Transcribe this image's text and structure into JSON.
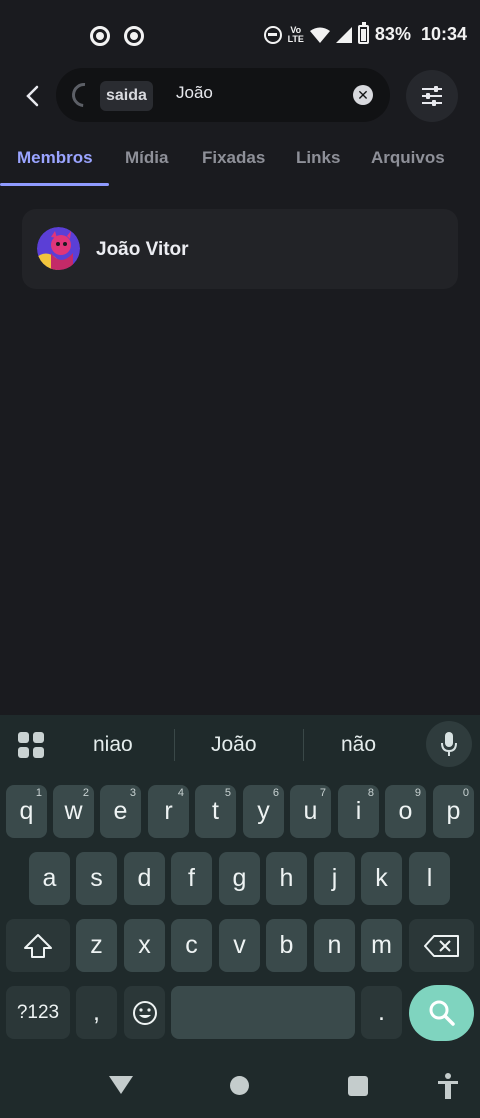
{
  "status_bar": {
    "battery": "83%",
    "time": "10:34",
    "network": "Vo LTE"
  },
  "search": {
    "filter_chip": "saida",
    "query": "João"
  },
  "tabs": [
    {
      "label": "Membros",
      "active": true
    },
    {
      "label": "Mídia"
    },
    {
      "label": "Fixadas"
    },
    {
      "label": "Links"
    },
    {
      "label": "Arquivos"
    }
  ],
  "results": [
    {
      "name": "João Vitor"
    }
  ],
  "keyboard": {
    "suggestions": [
      "niao",
      "João",
      "não"
    ],
    "row1": [
      {
        "key": "q",
        "hint": "1"
      },
      {
        "key": "w",
        "hint": "2"
      },
      {
        "key": "e",
        "hint": "3"
      },
      {
        "key": "r",
        "hint": "4"
      },
      {
        "key": "t",
        "hint": "5"
      },
      {
        "key": "y",
        "hint": "6"
      },
      {
        "key": "u",
        "hint": "7"
      },
      {
        "key": "i",
        "hint": "8"
      },
      {
        "key": "o",
        "hint": "9"
      },
      {
        "key": "p",
        "hint": "0"
      }
    ],
    "row2": [
      "a",
      "s",
      "d",
      "f",
      "g",
      "h",
      "j",
      "k",
      "l"
    ],
    "row3": [
      "z",
      "x",
      "c",
      "v",
      "b",
      "n",
      "m"
    ],
    "symbols_label": "?123",
    "comma": ",",
    "period": "."
  },
  "colors": {
    "accent": "#9aa4ff",
    "keyboard_bg": "#1f2a2b",
    "search_key": "#7fd4bf"
  }
}
